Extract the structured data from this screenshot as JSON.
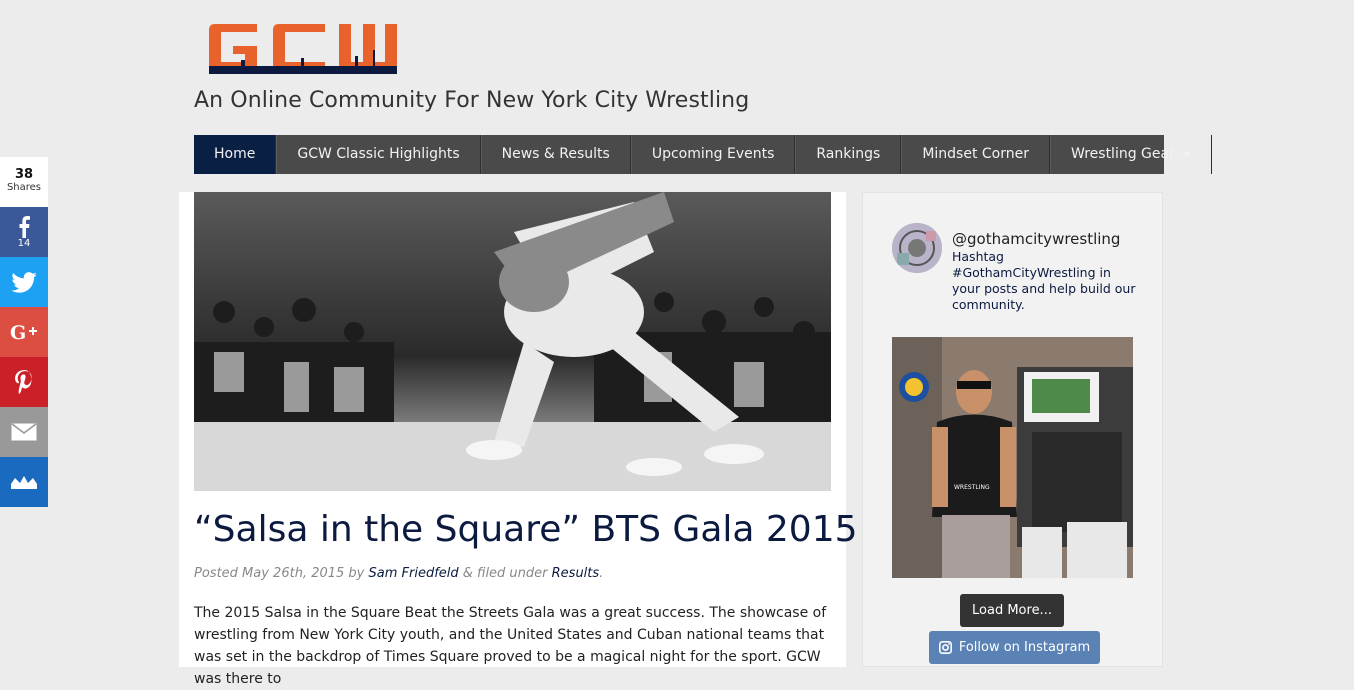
{
  "brand": {
    "logo_text": "GCW",
    "tagline": "An Online Community For New York City Wrestling"
  },
  "nav": {
    "items": [
      {
        "label": "Home"
      },
      {
        "label": "GCW Classic Highlights"
      },
      {
        "label": "News & Results"
      },
      {
        "label": "Upcoming Events"
      },
      {
        "label": "Rankings"
      },
      {
        "label": "Mindset Corner"
      },
      {
        "label": "Wrestling Gear"
      }
    ],
    "active": "Home"
  },
  "share": {
    "total": "38",
    "total_label": "Shares",
    "facebook_count": "14",
    "buttons": [
      "facebook-icon",
      "twitter-icon",
      "google-plus-icon",
      "pinterest-icon",
      "email-icon",
      "sumome-icon"
    ]
  },
  "post": {
    "title": "“Salsa in the Square” BTS Gala 2015",
    "posted_prefix": "Posted May 26th, 2015 by ",
    "author": "Sam Friedfeld",
    "filed_text": " & filed under ",
    "category": "Results",
    "period": ".",
    "body": "The 2015 Salsa in the Square Beat the Streets Gala was a great success. The showcase of wrestling from New York City youth, and the United States and Cuban national teams that was set in the backdrop of Times Square proved to be a magical night for the sport. GCW was there to"
  },
  "instagram": {
    "handle": "@gothamcitywrestling",
    "bio": "Hashtag #GothamCityWrestling in your posts and help build our community.",
    "load_more": "Load More...",
    "follow": "Follow on Instagram"
  },
  "colors": {
    "nav_active": "#0a1f44",
    "nav_bg": "#4a4a4a",
    "logo_orange": "#e8632c",
    "logo_navy": "#0b1a3e",
    "title": "#0b1a3e"
  }
}
